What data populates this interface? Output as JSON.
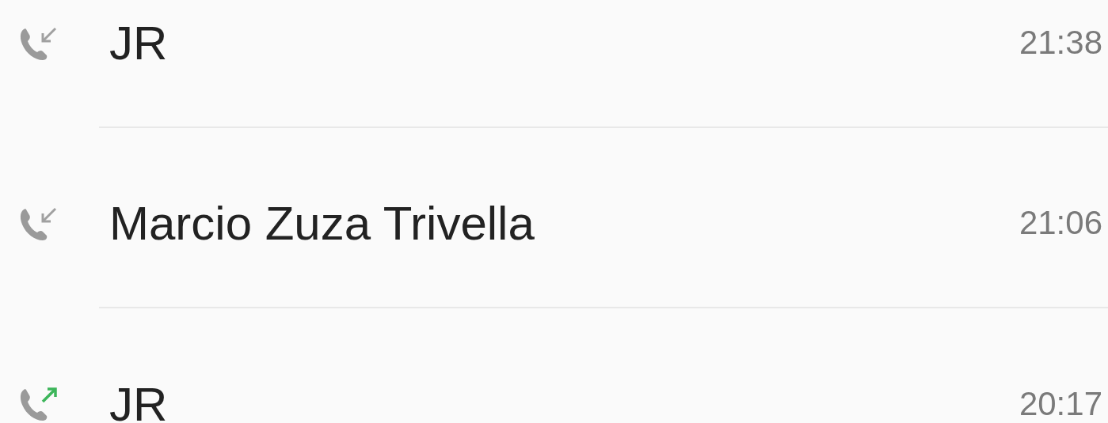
{
  "calls": [
    {
      "kind": "incoming",
      "name": "JR",
      "time": "21:38"
    },
    {
      "kind": "incoming",
      "name": "Marcio Zuza Trivella",
      "time": "21:06"
    },
    {
      "kind": "outgoing",
      "name": "JR",
      "time": "20:17"
    }
  ]
}
